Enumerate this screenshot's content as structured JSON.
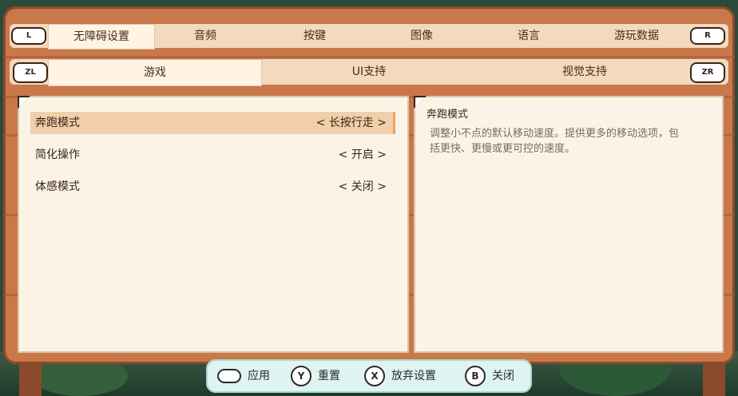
{
  "tabs": {
    "shoulder_left": "L",
    "shoulder_right": "R",
    "items": [
      "无障碍设置",
      "音频",
      "按键",
      "图像",
      "语言",
      "游玩数据"
    ],
    "active_index": 0
  },
  "subtabs": {
    "trigger_left": "ZL",
    "trigger_right": "ZR",
    "items": [
      "游戏",
      "UI支持",
      "视觉支持"
    ],
    "active_index": 0
  },
  "options": [
    {
      "label": "奔跑模式",
      "value": "< 长按行走 >",
      "selected": true
    },
    {
      "label": "简化操作",
      "value": "< 开启 >",
      "selected": false
    },
    {
      "label": "体感模式",
      "value": "< 关闭 >",
      "selected": false
    }
  ],
  "description": {
    "title": "奔跑模式",
    "body": "调整小不点的默认移动速度。提供更多的移动选项，包括更快、更慢或更可控的速度。"
  },
  "footer": {
    "apply_label": "应用",
    "reset_key": "Y",
    "reset_label": "重置",
    "discard_key": "X",
    "discard_label": "放弃设置",
    "close_key": "B",
    "close_label": "关闭"
  },
  "colors": {
    "board": "#c9784a",
    "paper": "#fbf4e6",
    "selection": "#f1cfaa",
    "footer_bg": "#dff3f0"
  }
}
